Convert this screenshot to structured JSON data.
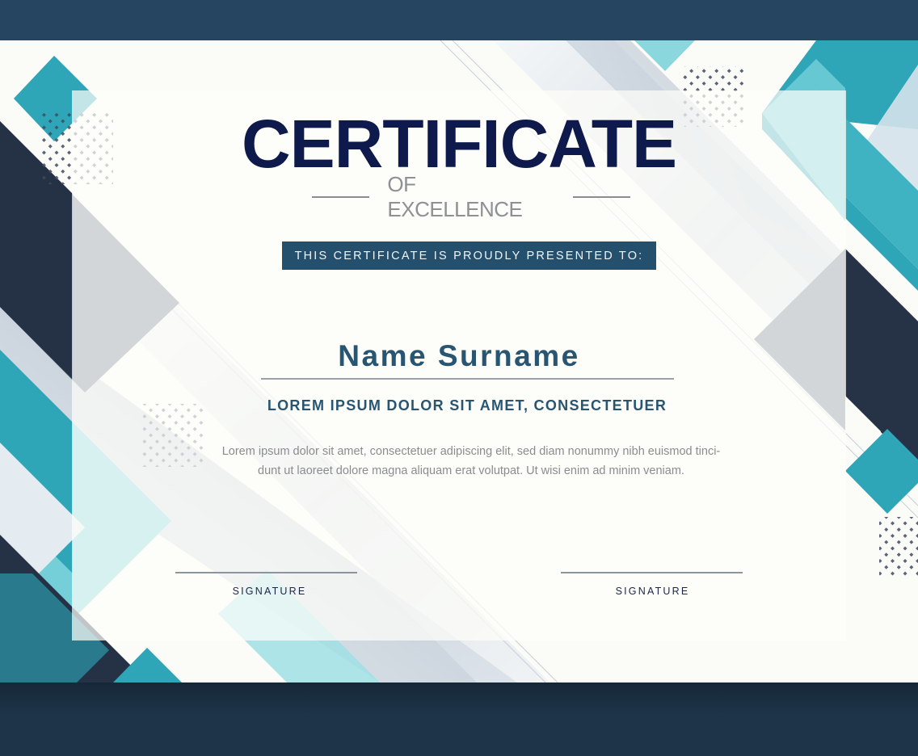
{
  "certificate": {
    "title": "CERTIFICATE",
    "subtitle": "OF EXCELLENCE",
    "presented_to": "THIS CERTIFICATE IS PROUDLY PRESENTED TO:",
    "recipient_name": "Name Surname",
    "headline": "LOREM IPSUM DOLOR SIT AMET, CONSECTETUER",
    "body_line_1": "Lorem ipsum dolor sit amet, consectetuer adipiscing elit, sed diam nonummy nibh euismod tinci-",
    "body_line_2": "dunt ut laoreet dolore magna aliquam erat volutpat. Ut wisi enim ad minim veniam.",
    "signature_left": "SIGNATURE",
    "signature_right": "SIGNATURE"
  },
  "colors": {
    "navy": "#0f1a4c",
    "teal": "#2fa6b8",
    "light_teal": "#6dccd6",
    "dark_slate": "#253246",
    "slate": "#5d6d80",
    "banner": "#24506e",
    "background": "#223f58"
  }
}
